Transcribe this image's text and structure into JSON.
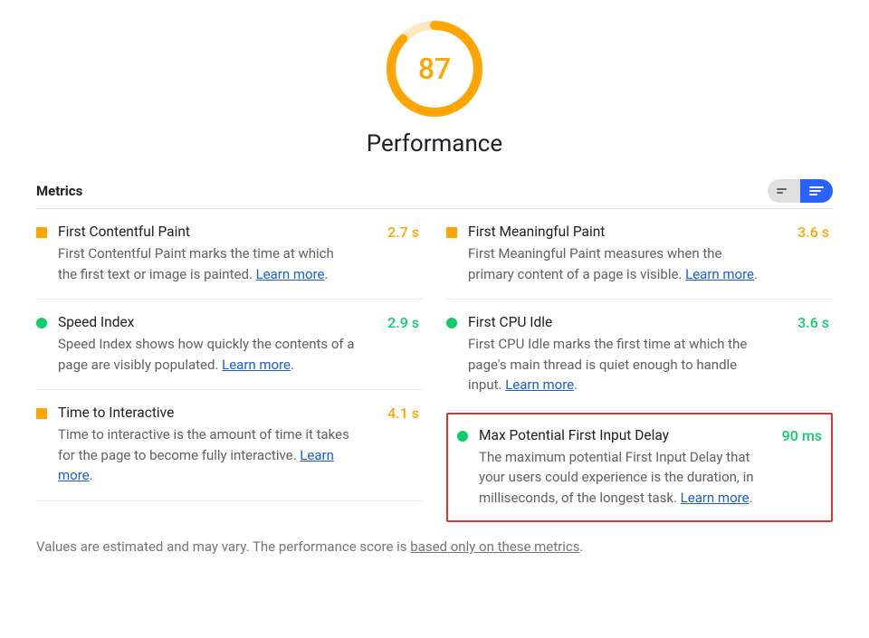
{
  "score": "87",
  "category": "Performance",
  "metrics_heading": "Metrics",
  "learn_more_text": "Learn more",
  "gauge": {
    "percent": 87,
    "color": "#FFA400",
    "bg": "#FFE8BF"
  },
  "metrics_left": [
    {
      "marker": "square",
      "title": "First Contentful Paint",
      "value": "2.7 s",
      "value_color": "orange",
      "desc_pre": "First Contentful Paint marks the time at which the first text or image is painted. ",
      "desc_post": "."
    },
    {
      "marker": "circle",
      "title": "Speed Index",
      "value": "2.9 s",
      "value_color": "green",
      "desc_pre": "Speed Index shows how quickly the contents of a page are visibly populated. ",
      "desc_post": "."
    },
    {
      "marker": "square",
      "title": "Time to Interactive",
      "value": "4.1 s",
      "value_color": "orange",
      "desc_pre": "Time to interactive is the amount of time it takes for the page to become fully interactive. ",
      "desc_post": "."
    }
  ],
  "metrics_right": [
    {
      "marker": "square",
      "title": "First Meaningful Paint",
      "value": "3.6 s",
      "value_color": "orange",
      "desc_pre": "First Meaningful Paint measures when the primary content of a page is visible. ",
      "desc_post": "."
    },
    {
      "marker": "circle",
      "title": "First CPU Idle",
      "value": "3.6 s",
      "value_color": "green",
      "desc_pre": "First CPU Idle marks the first time at which the page's main thread is quiet enough to handle input. ",
      "desc_post": "."
    },
    {
      "marker": "circle",
      "title": "Max Potential First Input Delay",
      "value": "90 ms",
      "value_color": "green",
      "highlight": true,
      "desc_pre": "The maximum potential First Input Delay that your users could experience is the duration, in milliseconds, of the longest task. ",
      "desc_post": "."
    }
  ],
  "footnote_pre": "Values are estimated and may vary. The performance score is ",
  "footnote_link": "based only on these metrics",
  "footnote_post": "."
}
